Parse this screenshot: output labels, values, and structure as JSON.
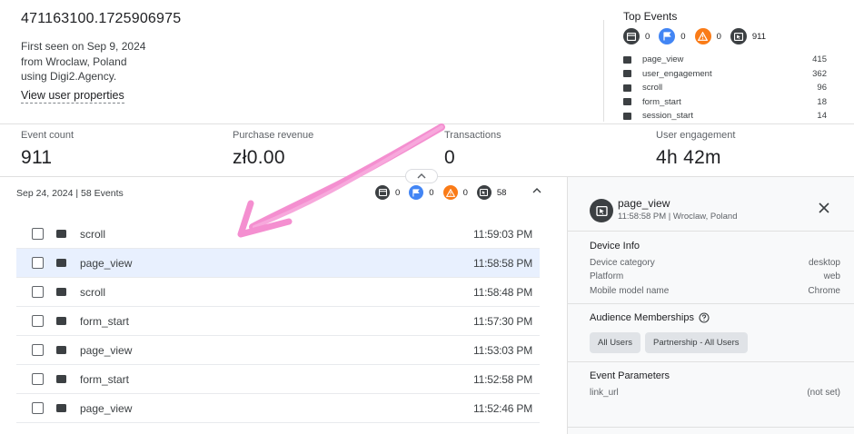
{
  "user": {
    "id": "471163100.1725906975",
    "first_seen": "First seen on Sep 9, 2024",
    "location": "from Wroclaw, Poland",
    "source": "using Digi2.Agency.",
    "view_properties": "View user properties"
  },
  "top_events": {
    "title": "Top Events",
    "counts": [
      {
        "icon": "window-icon",
        "color": "#3c4043",
        "value": "0"
      },
      {
        "icon": "flag-icon",
        "color": "#4285f4",
        "value": "0"
      },
      {
        "icon": "warning-icon",
        "color": "#fa7b17",
        "value": "0"
      },
      {
        "icon": "cursor-icon",
        "color": "#3c4043",
        "value": "911"
      }
    ],
    "items": [
      {
        "name": "page_view",
        "count": "415"
      },
      {
        "name": "user_engagement",
        "count": "362"
      },
      {
        "name": "scroll",
        "count": "96"
      },
      {
        "name": "form_start",
        "count": "18"
      },
      {
        "name": "session_start",
        "count": "14"
      }
    ]
  },
  "metrics": [
    {
      "label": "Event count",
      "value": "911"
    },
    {
      "label": "Purchase revenue",
      "value": "zł0.00"
    },
    {
      "label": "Transactions",
      "value": "0"
    },
    {
      "label": "User engagement",
      "value": "4h 42m"
    }
  ],
  "timeline": {
    "day_header": "Sep 24, 2024 | 58 Events",
    "counts": [
      "0",
      "0",
      "0",
      "58"
    ],
    "events": [
      {
        "name": "scroll",
        "time": "11:59:03 PM"
      },
      {
        "name": "page_view",
        "time": "11:58:58 PM"
      },
      {
        "name": "scroll",
        "time": "11:58:48 PM"
      },
      {
        "name": "form_start",
        "time": "11:57:30 PM"
      },
      {
        "name": "page_view",
        "time": "11:53:03 PM"
      },
      {
        "name": "form_start",
        "time": "11:52:58 PM"
      },
      {
        "name": "page_view",
        "time": "11:52:46 PM"
      }
    ]
  },
  "detail": {
    "title": "page_view",
    "subtitle": "11:58:58 PM | Wroclaw, Poland",
    "device_info": {
      "heading": "Device Info",
      "rows": [
        {
          "key": "Device category",
          "value": "desktop"
        },
        {
          "key": "Platform",
          "value": "web"
        },
        {
          "key": "Mobile model name",
          "value": "Chrome"
        }
      ]
    },
    "audience": {
      "heading": "Audience Memberships",
      "chips": [
        "All Users",
        "Partnership - All Users"
      ]
    },
    "params": {
      "heading": "Event Parameters",
      "rows": [
        {
          "key": "link_url",
          "value": "(not set)"
        }
      ]
    }
  },
  "colors": {
    "accent_blue": "#4285f4",
    "warning_orange": "#fa7b17",
    "selected_row": "#e8f0fe",
    "annotation_pink": "#f48fd0"
  }
}
